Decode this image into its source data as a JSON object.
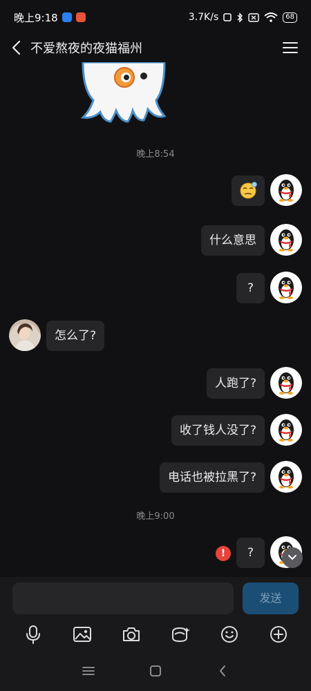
{
  "status_bar": {
    "time": "晚上9:18",
    "net_speed": "3.7K/s",
    "battery": "68"
  },
  "header": {
    "title": "不爱熬夜的夜猫福州"
  },
  "messages": [
    {
      "type": "time",
      "text": "晚上8:54"
    },
    {
      "type": "out",
      "text": "emoji-thinking"
    },
    {
      "type": "out",
      "text": "什么意思"
    },
    {
      "type": "out",
      "text": "?"
    },
    {
      "type": "in",
      "text": "怎么了?"
    },
    {
      "type": "out",
      "text": "人跑了?"
    },
    {
      "type": "out",
      "text": "收了钱人没了?"
    },
    {
      "type": "out",
      "text": "电话也被拉黑了?"
    },
    {
      "type": "time",
      "text": "晚上9:00"
    },
    {
      "type": "out",
      "text": "?",
      "failed": true
    }
  ],
  "error_badge": "!",
  "input": {
    "placeholder": "",
    "send_label": "发送"
  },
  "toolbar": [
    "mic-icon",
    "image-icon",
    "camera-icon",
    "red-packet-icon",
    "emoji-icon",
    "plus-icon"
  ],
  "nav": [
    "menu-icon",
    "home-icon",
    "back-icon"
  ],
  "colors": {
    "background": "#111113",
    "bubble": "#262629",
    "send_button": "#1a4e75",
    "error": "#e5443b"
  }
}
